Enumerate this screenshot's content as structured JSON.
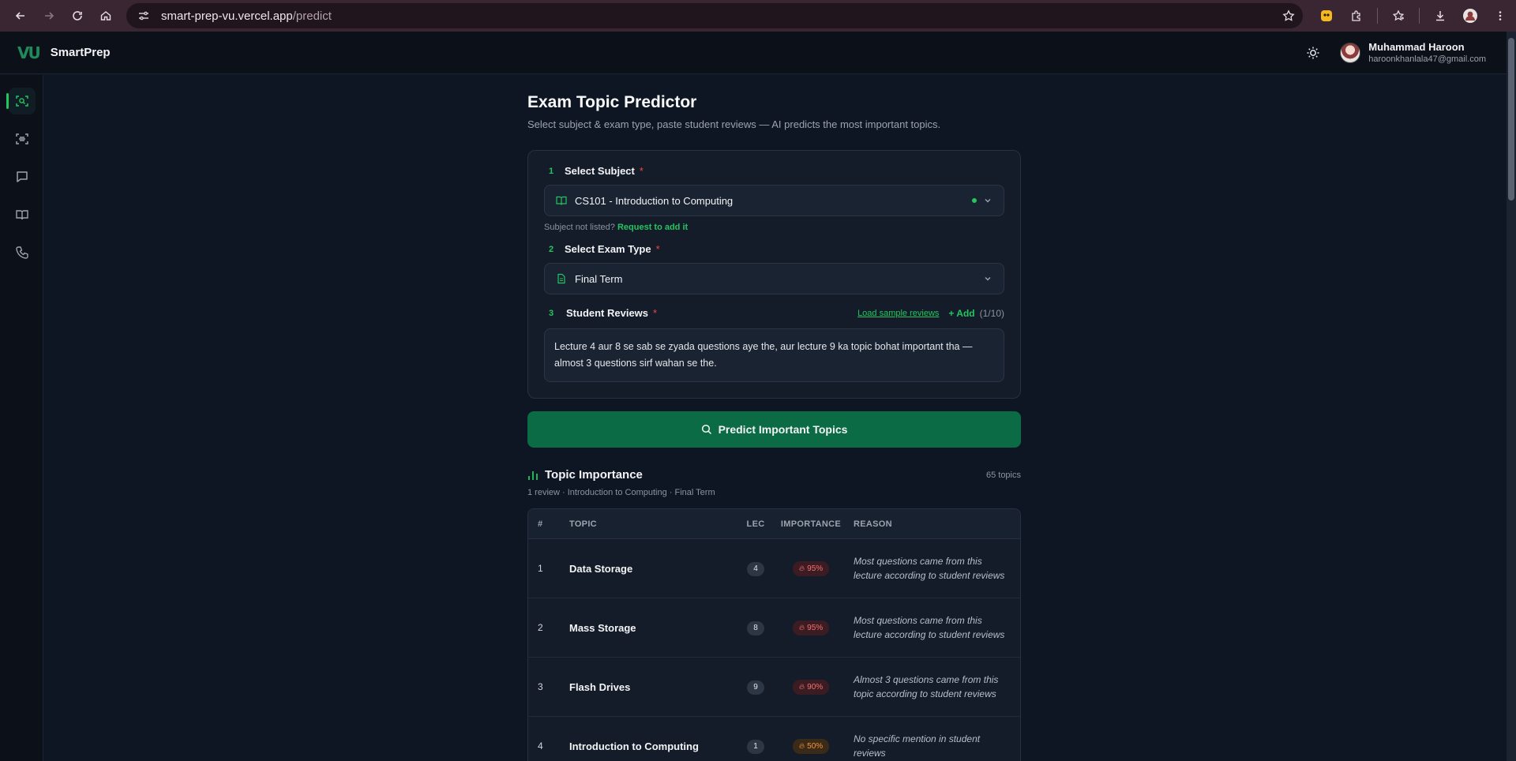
{
  "browser": {
    "url_host": "smart-prep-vu.vercel.app",
    "url_path": "/predict"
  },
  "app": {
    "logo": "VU",
    "brand": "SmartPrep",
    "user_name": "Muhammad Haroon",
    "user_email": "haroonkhanlala47@gmail.com"
  },
  "sidebar": {
    "items": [
      {
        "icon": "scan-icon",
        "active": true
      },
      {
        "icon": "text-scan-icon",
        "active": false
      },
      {
        "icon": "chat-icon",
        "active": false
      },
      {
        "icon": "book-icon",
        "active": false
      },
      {
        "icon": "phone-icon",
        "active": false
      }
    ]
  },
  "page": {
    "title": "Exam Topic Predictor",
    "subtitle": "Select subject & exam type, paste student reviews — AI predicts the most important topics."
  },
  "form": {
    "subject": {
      "step": "1",
      "label": "Select Subject",
      "required": "*",
      "value": "CS101 - Introduction to Computing",
      "hint": "Subject not listed?",
      "hint_link": "Request to add it"
    },
    "exam": {
      "step": "2",
      "label": "Select Exam Type",
      "required": "*",
      "value": "Final Term"
    },
    "reviews": {
      "step": "3",
      "label": "Student Reviews",
      "required": "*",
      "load_sample": "Load sample reviews",
      "add": "+ Add",
      "count": "(1/10)",
      "text": "Lecture 4 aur 8 se sab se zyada questions aye the, aur lecture 9 ka topic bohat important tha — almost 3 questions sirf wahan se the."
    },
    "predict_button": "Predict Important Topics"
  },
  "results": {
    "title": "Topic Importance",
    "total": "65 topics",
    "summary": "1 review · Introduction to Computing · Final Term",
    "headers": {
      "num": "#",
      "topic": "TOPIC",
      "lec": "LEC",
      "importance": "IMPORTANCE",
      "reason": "REASON"
    },
    "rows": [
      {
        "num": "1",
        "topic": "Data Storage",
        "lec": "4",
        "importance": "95%",
        "reason": "Most questions came from this lecture according to student reviews"
      },
      {
        "num": "2",
        "topic": "Mass Storage",
        "lec": "8",
        "importance": "95%",
        "reason": "Most questions came from this lecture according to student reviews"
      },
      {
        "num": "3",
        "topic": "Flash Drives",
        "lec": "9",
        "importance": "90%",
        "reason": "Almost 3 questions came from this topic according to student reviews"
      },
      {
        "num": "4",
        "topic": "Introduction to Computing",
        "lec": "1",
        "importance": "50%",
        "reason": "No specific mention in student reviews"
      }
    ]
  },
  "colors": {
    "accent": "#22c55e",
    "primary_button": "#0b6b44",
    "danger": "#ef4444"
  }
}
